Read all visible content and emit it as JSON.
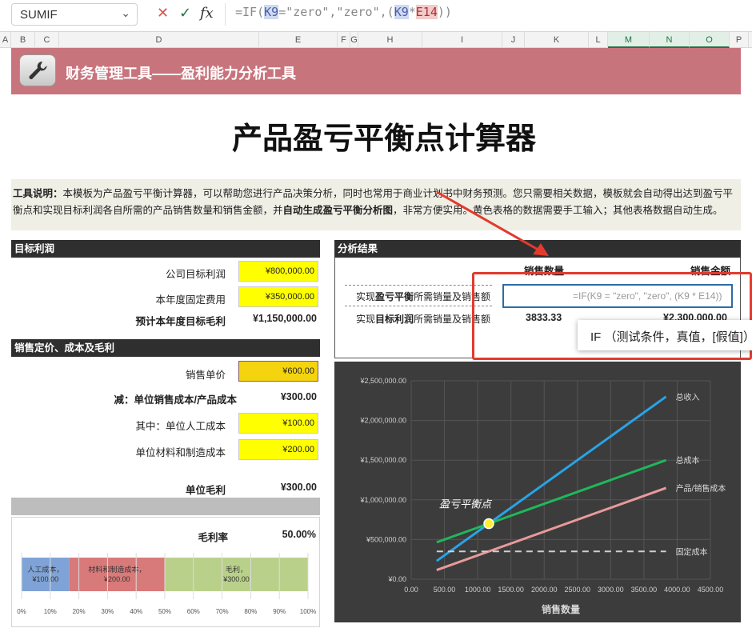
{
  "formula_bar": {
    "name_box": "SUMIF",
    "cancel_icon": "x-icon",
    "confirm_icon": "check-icon",
    "fx_label": "fx",
    "formula_prefix": "=IF(",
    "ref1": "K9",
    "formula_mid": "=\"zero\",\"zero\",(",
    "ref1b": "K9",
    "star": "*",
    "ref2": "E14",
    "formula_suffix": "))"
  },
  "columns": [
    {
      "label": "A",
      "w": 14
    },
    {
      "label": "B",
      "w": 30
    },
    {
      "label": "C",
      "w": 30
    },
    {
      "label": "D",
      "w": 250
    },
    {
      "label": "E",
      "w": 98
    },
    {
      "label": "F",
      "w": 16
    },
    {
      "label": "G",
      "w": 10
    },
    {
      "label": "H",
      "w": 80
    },
    {
      "label": "I",
      "w": 100
    },
    {
      "label": "J",
      "w": 28
    },
    {
      "label": "K",
      "w": 80
    },
    {
      "label": "L",
      "w": 24
    },
    {
      "label": "M",
      "w": 52
    },
    {
      "label": "N",
      "w": 50
    },
    {
      "label": "O",
      "w": 50
    },
    {
      "label": "P",
      "w": 24
    }
  ],
  "header": {
    "banner_title": "财务管理工具——盈利能力分析工具",
    "page_title": "产品盈亏平衡点计算器"
  },
  "description": {
    "lead": "工具说明：",
    "text1": "本模板为产品盈亏平衡计算器，可以帮助您进行产品决策分析，同时也常用于商业计划书中财务预测。您只需要相关数据，模板就会自动得出达到盈亏平衡点和实现目标利润各自所需的产品销售数量和销售金额，并",
    "bold2": "自动生成盈亏平衡分析图",
    "text3": "，非常方便实用。黄色表格的数据需要手工输入；其他表格数据自动生成。"
  },
  "target_profit": {
    "section": "目标利润",
    "company_target_label": "公司目标利润",
    "company_target_value": "¥800,000.00",
    "fixed_cost_label": "本年度固定费用",
    "fixed_cost_value": "¥350,000.00",
    "gross_target_label": "预计本年度目标毛利",
    "gross_target_value": "¥1,150,000.00"
  },
  "pricing": {
    "section": "销售定价、成本及毛利",
    "unit_price_label": "销售单价",
    "unit_price_value": "¥600.00",
    "unit_cost_label": "减：单位销售成本/产品成本",
    "unit_cost_value": "¥300.00",
    "labor_label": "其中：单位人工成本",
    "labor_value": "¥100.00",
    "material_label": "单位材料和制造成本",
    "material_value": "¥200.00",
    "unit_margin_label": "单位毛利",
    "unit_margin_value": "¥300.00",
    "margin_rate_label": "毛利率",
    "margin_rate_value": "50.00%"
  },
  "analysis": {
    "section": "分析结果",
    "col_qty": "销售数量",
    "col_amount": "销售金额",
    "row1_label_a": "实现",
    "row1_label_b": "盈亏平衡",
    "row1_label_c": "所需销量及销售额",
    "row2_label_a": "实现",
    "row2_label_b": "目标利润",
    "row2_label_c": "所需销量及销售额",
    "row2_qty": "3833.33",
    "row2_amount": "¥2,300,000.00",
    "active_cell_formula": "=IF(K9 = \"zero\", \"zero\", (K9 * E14))",
    "tooltip": "IF （测试条件，真值，[假值]）"
  },
  "bar_chart": {
    "segments": [
      {
        "label": "人工成本，¥100.00",
        "value": 100,
        "color": "#7fa3d6"
      },
      {
        "label": "材料和制造成本，¥200.00",
        "value": 200,
        "color": "#d97a7a"
      },
      {
        "label": "毛利，¥300.00",
        "value": 300,
        "color": "#b9d08a"
      }
    ],
    "ticks": [
      "0%",
      "10%",
      "20%",
      "30%",
      "40%",
      "50%",
      "60%",
      "70%",
      "80%",
      "90%",
      "100%"
    ]
  },
  "chart_data": {
    "type": "line",
    "title": "",
    "xlabel": "销售数量",
    "ylabel": "",
    "xlim": [
      0,
      4500
    ],
    "ylim": [
      0,
      2500000
    ],
    "x_ticks": [
      "0.00",
      "500.00",
      "1000.00",
      "1500.00",
      "2000.00",
      "2500.00",
      "3000.00",
      "3500.00",
      "4000.00",
      "4500.00"
    ],
    "y_ticks": [
      "¥0.00",
      "¥500,000.00",
      "¥1,000,000.00",
      "¥1,500,000.00",
      "¥2,000,000.00",
      "¥2,500,000.00"
    ],
    "grid": true,
    "series": [
      {
        "name": "总收入",
        "color": "#29a3e6",
        "x": [
          383,
          3833
        ],
        "y": [
          230000,
          2300000
        ]
      },
      {
        "name": "总成本",
        "color": "#1fb85a",
        "x": [
          383,
          3833
        ],
        "y": [
          465000,
          1500000
        ]
      },
      {
        "name": "产品/销售成本",
        "color": "#e99a9a",
        "x": [
          383,
          3833
        ],
        "y": [
          115000,
          1150000
        ]
      },
      {
        "name": "固定成本",
        "color": "#cfcfcf",
        "dash": true,
        "x": [
          383,
          3833
        ],
        "y": [
          350000,
          350000
        ]
      }
    ],
    "annotation": {
      "label": "盈亏平衡点",
      "x": 1167,
      "y": 700000
    }
  }
}
